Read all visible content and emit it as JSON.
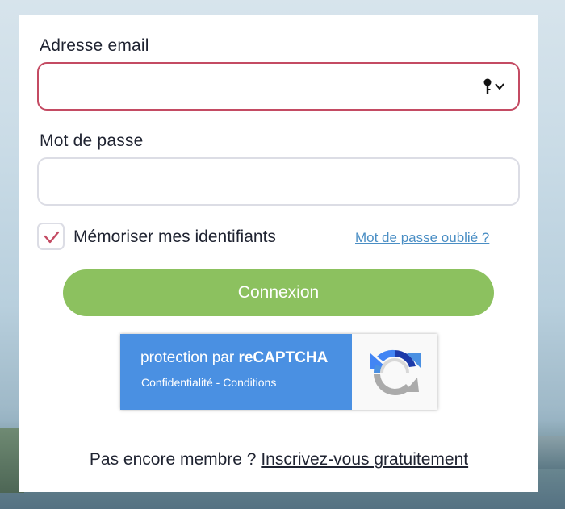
{
  "form": {
    "email_label": "Adresse email",
    "email_value": "",
    "password_label": "Mot de passe",
    "password_value": "",
    "remember_label": "Mémoriser mes identifiants",
    "remember_checked": true,
    "forgot_link": "Mot de passe oublié ?",
    "login_button": "Connexion"
  },
  "recaptcha": {
    "title_prefix": "protection par ",
    "title_brand": "reCAPTCHA",
    "privacy_link": "Confidentialité",
    "separator": " - ",
    "terms_link": "Conditions"
  },
  "footer": {
    "prompt": "Pas encore membre ? ",
    "signup_link": "Inscrivez-vous gratuitement"
  },
  "icons": {
    "password_manager": "key-icon",
    "dropdown": "chevron-down-icon",
    "checkmark": "check-icon",
    "recaptcha": "recaptcha-logo-icon"
  },
  "colors": {
    "accent_green": "#8cc15f",
    "error_border": "#c44b63",
    "link_blue": "#4a8ec4",
    "recaptcha_blue": "#4a90e2",
    "text_dark": "#1f2331"
  }
}
